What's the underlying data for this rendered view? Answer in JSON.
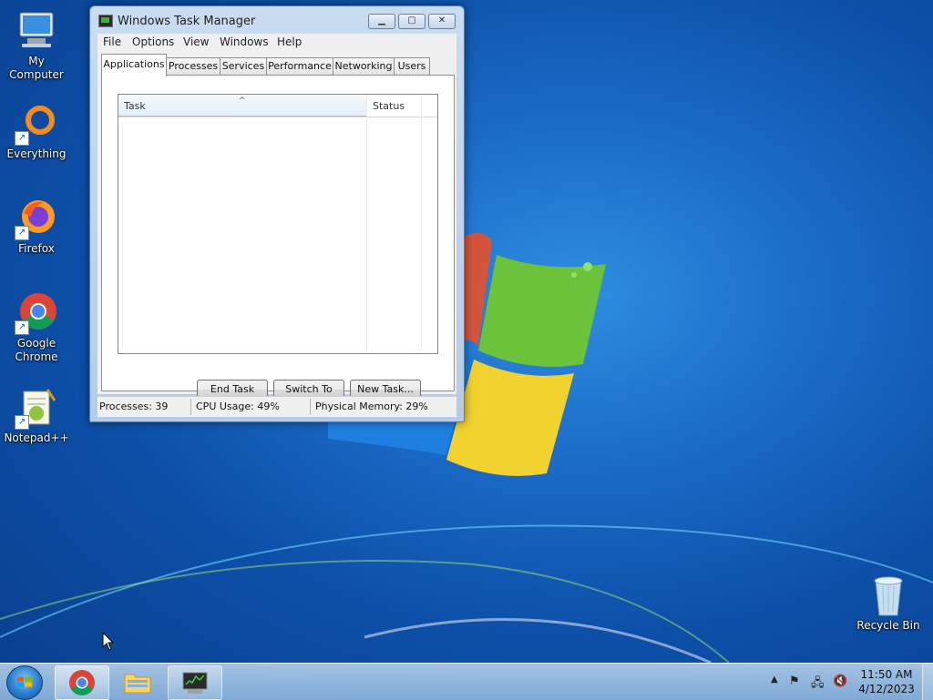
{
  "desktop": {
    "icons": [
      {
        "label": "My Computer"
      },
      {
        "label": "Everything"
      },
      {
        "label": "Firefox"
      },
      {
        "label": "Google Chrome"
      },
      {
        "label": "Notepad++"
      },
      {
        "label": "Recycle Bin"
      }
    ]
  },
  "window": {
    "title": "Windows Task Manager",
    "menu": [
      "File",
      "Options",
      "View",
      "Windows",
      "Help"
    ],
    "tabs": [
      "Applications",
      "Processes",
      "Services",
      "Performance",
      "Networking",
      "Users"
    ],
    "active_tab": "Applications",
    "list": {
      "columns": [
        "Task",
        "Status"
      ],
      "rows": []
    },
    "buttons": {
      "end_task": "End Task",
      "switch_to": "Switch To",
      "new_task": "New Task..."
    },
    "status": {
      "processes": "Processes: 39",
      "cpu": "CPU Usage: 49%",
      "memory": "Physical Memory: 29%"
    }
  },
  "taskbar": {
    "pinned": [
      "chrome-icon",
      "explorer-icon",
      "task-manager-icon"
    ],
    "clock": {
      "time": "11:50 AM",
      "date": "4/12/2023"
    }
  },
  "colors": {
    "desktop_bg": "#1a6bc7",
    "window_frame": "#c9dcf0",
    "taskbar": "#a9c8e8"
  }
}
